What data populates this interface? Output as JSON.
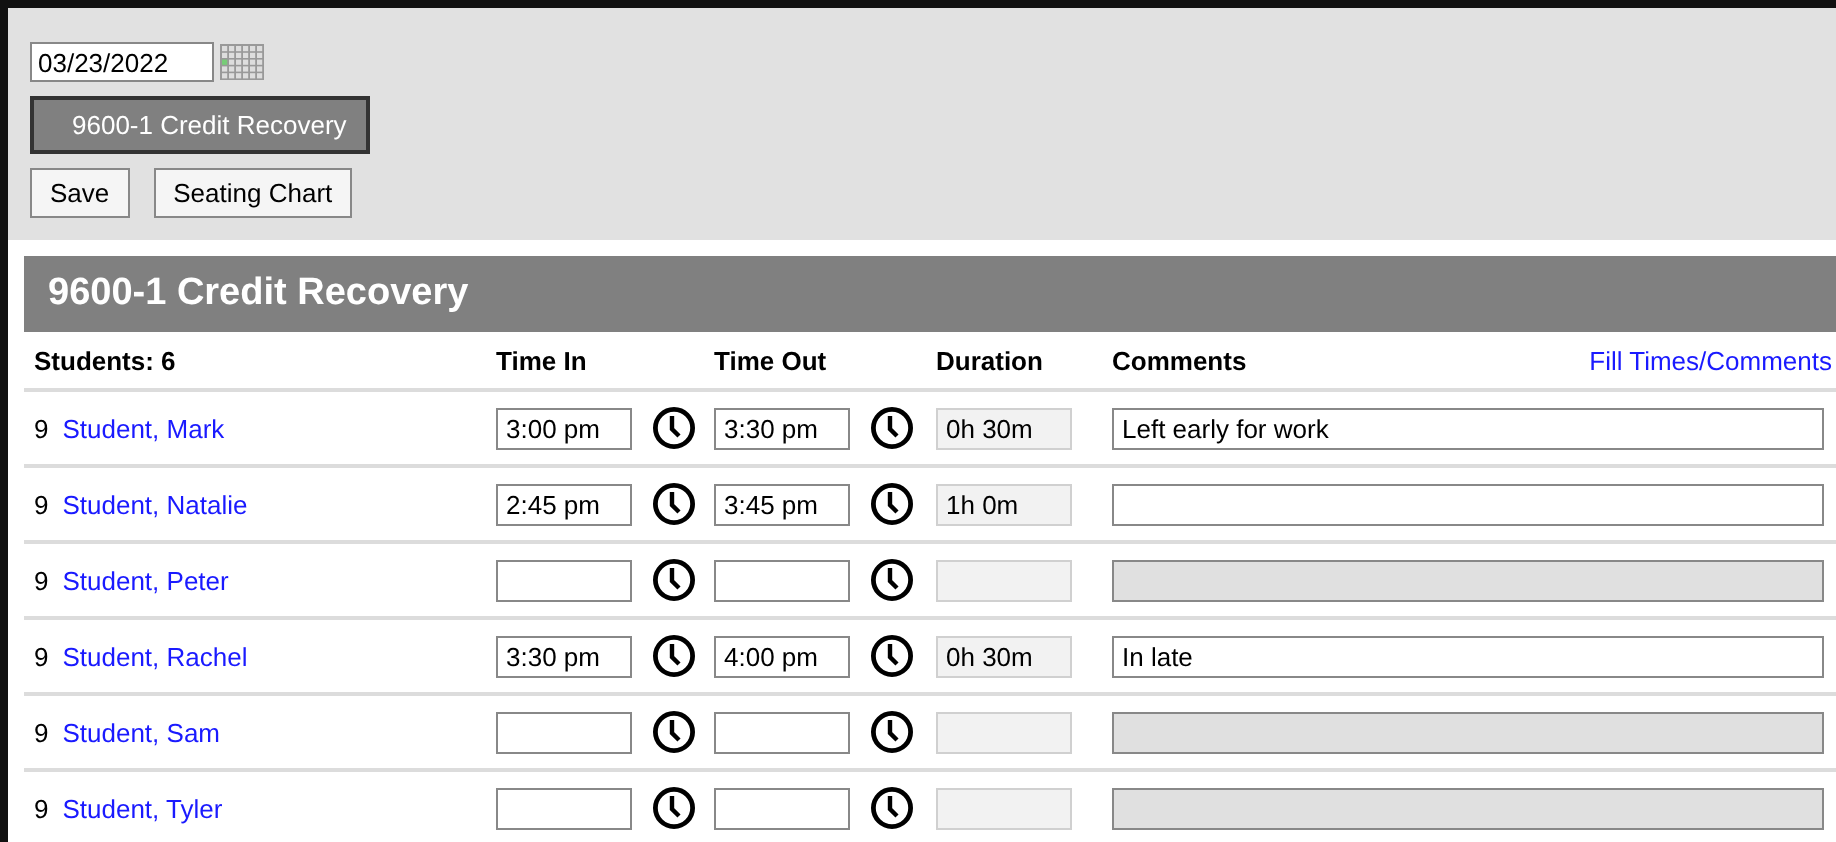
{
  "date_field": {
    "value": "03/23/2022"
  },
  "section_button": {
    "label": "9600-1 Credit Recovery"
  },
  "buttons": [
    "Save",
    "Seating Chart"
  ],
  "section_title": "9600-1 Credit Recovery",
  "columns": {
    "students": "Students: 6",
    "time_in": "Time In",
    "time_out": "Time Out",
    "duration": "Duration",
    "comments": "Comments",
    "action": "Fill Times/Comments"
  },
  "rows": [
    {
      "grade": "9",
      "name": "Student, Mark",
      "time_in": "3:00 pm",
      "time_out": "3:30 pm",
      "duration": "0h 30m",
      "comment": "Left early for work",
      "comment_disabled": false
    },
    {
      "grade": "9",
      "name": "Student, Natalie",
      "time_in": "2:45 pm",
      "time_out": "3:45 pm",
      "duration": "1h 0m",
      "comment_disabled": false
    },
    {
      "grade": "9",
      "name": "Student, Peter",
      "comment_disabled": true
    },
    {
      "grade": "9",
      "name": "Student, Rachel",
      "time_in": "3:30 pm",
      "time_out": "4:00 pm",
      "duration": "0h 30m",
      "comment": "In late",
      "comment_disabled": false
    },
    {
      "grade": "9",
      "name": "Student, Sam",
      "comment_disabled": true
    },
    {
      "grade": "9",
      "name": "Student, Tyler",
      "comment_disabled": true
    }
  ]
}
